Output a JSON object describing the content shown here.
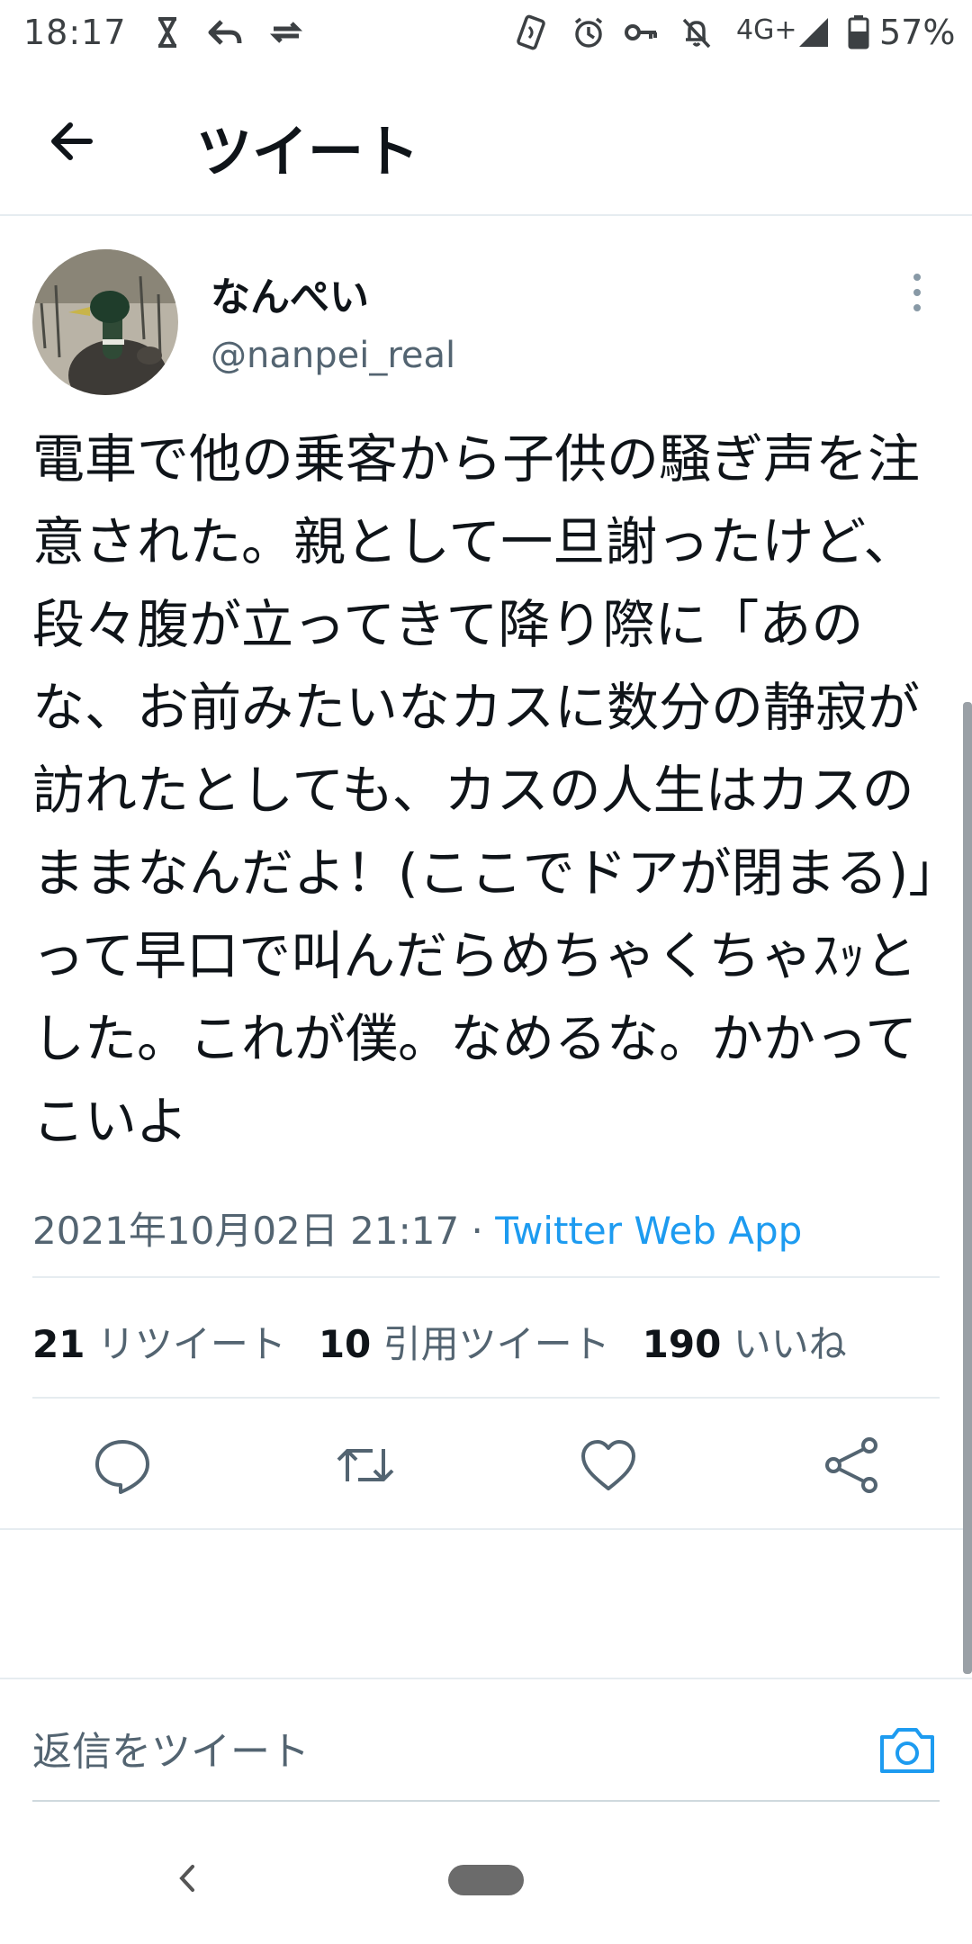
{
  "status_bar": {
    "time": "18:17",
    "icons_left": [
      "hourglass-icon",
      "reply-arrow-icon",
      "sync-icon"
    ],
    "icons_right": [
      "nfc-icon",
      "alarm-icon",
      "vpn-key-icon",
      "mute-icon",
      "signal-icon",
      "battery-icon"
    ],
    "network": "4G+",
    "battery": "57%"
  },
  "header": {
    "title": "ツイート"
  },
  "tweet": {
    "display_name": "なんぺい",
    "handle": "@nanpei_real",
    "text": "電車で他の乗客から子供の騒ぎ声を注意された。親として一旦謝ったけど、段々腹が立ってきて降り際に「あのな、お前みたいなカスに数分の静寂が訪れたとしても、カスの人生はカスのままなんだよ！(ここでドアが閉まる)」って早口で叫んだらめちゃくちゃｽｯとした。これが僕。なめるな。かかってこいよ",
    "timestamp": "2021年10月02日 21:17",
    "separator": " · ",
    "source": "Twitter Web App"
  },
  "stats": {
    "retweets_count": "21",
    "retweets_label": "リツイート",
    "quotes_count": "10",
    "quotes_label": "引用ツイート",
    "likes_count": "190",
    "likes_label": "いいね"
  },
  "actions": [
    "reply-icon",
    "retweet-icon",
    "like-icon",
    "share-icon"
  ],
  "reply_bar": {
    "placeholder": "返信をツイート"
  },
  "colors": {
    "link": "#1d9bf0",
    "secondary_text": "#536471",
    "divider": "#e6ecf0"
  }
}
